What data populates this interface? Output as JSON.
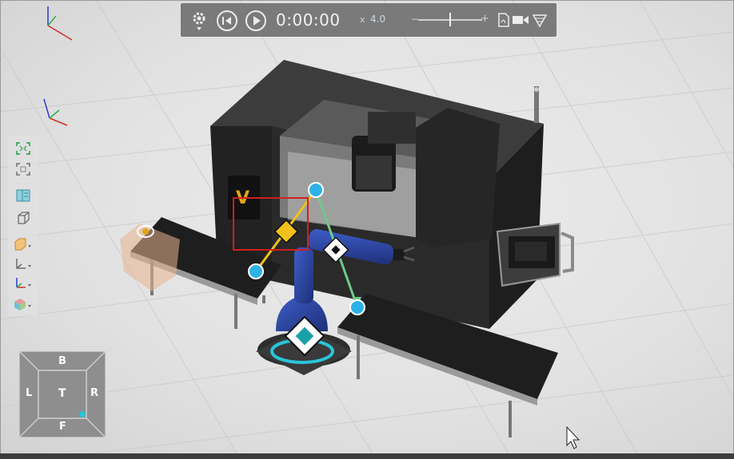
{
  "playback": {
    "settings_icon": "gear-icon",
    "rewind_icon": "skip-back-icon",
    "play_icon": "play-icon",
    "time": "0:00:00",
    "speed_prefix": "x",
    "speed": "4.0",
    "speed_minus": "−",
    "speed_plus": "+",
    "pdf_icon": "pdf-export-icon",
    "record_icon": "video-camera-icon",
    "effects_icon": "render-effects-icon"
  },
  "left_tools": [
    {
      "name": "fit-all-icon"
    },
    {
      "name": "fit-selection-icon"
    },
    {
      "name": "split-view-icon"
    },
    {
      "name": "wireframe-cube-icon"
    },
    {
      "name": "shaded-box-icon"
    },
    {
      "name": "axes-frame-icon"
    },
    {
      "name": "axes-colored-icon"
    },
    {
      "name": "render-mode-icon"
    }
  ],
  "view_cube": {
    "top": "B",
    "left": "L",
    "center": "T",
    "right": "R",
    "bottom": "F"
  },
  "colors": {
    "accent_cyan": "#29c4d8",
    "handle_yellow": "#f0c21a",
    "handle_green": "#6fc98a",
    "selection_red": "#d21e1e",
    "robot_blue": "#2b48a6",
    "cnc_body": "#2c2c2c"
  }
}
